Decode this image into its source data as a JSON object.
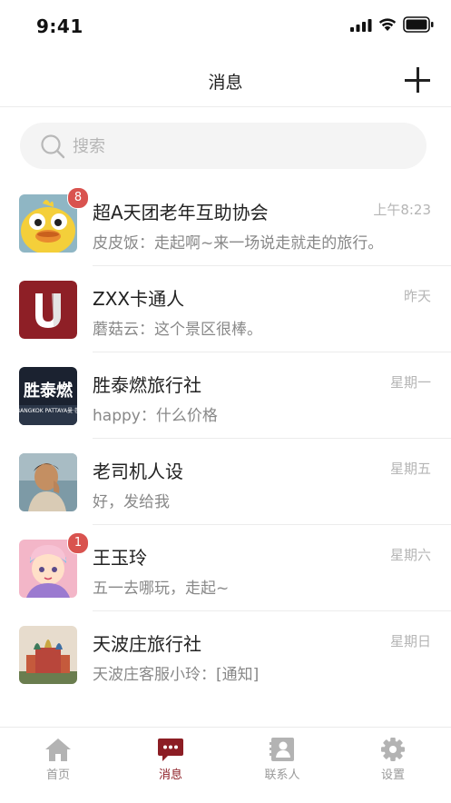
{
  "status_bar": {
    "time": "9:41"
  },
  "header": {
    "title": "消息"
  },
  "search": {
    "placeholder": "搜索"
  },
  "conversations": [
    {
      "name": "超A天团老年互助协会",
      "preview": "皮皮饭：走起啊~来一场说走就走的旅行。",
      "time": "上午8:23",
      "badge": "8"
    },
    {
      "name": "ZXX卡通人",
      "preview": "蘑菇云：这个景区很棒。",
      "time": "昨天"
    },
    {
      "name": "胜泰燃旅行社",
      "preview": "happy：什么价格",
      "time": "星期一",
      "avatar_text": "胜泰燃",
      "avatar_subtext": "BANGKOK PATTAYA曼·芭"
    },
    {
      "name": "老司机人设",
      "preview": "好，发给我",
      "time": "星期五"
    },
    {
      "name": "王玉玲",
      "preview": "五一去哪玩，走起~",
      "time": "星期六",
      "badge": "1"
    },
    {
      "name": "天波庄旅行社",
      "preview": "天波庄客服小玲：[通知]",
      "time": "星期日"
    }
  ],
  "tabs": [
    {
      "label": "首页",
      "icon": "home-icon"
    },
    {
      "label": "消息",
      "icon": "chat-icon",
      "active": true
    },
    {
      "label": "联系人",
      "icon": "contacts-icon"
    },
    {
      "label": "设置",
      "icon": "gear-icon"
    }
  ],
  "colors": {
    "accent": "#8c1d24",
    "badge": "#d9534f",
    "muted": "#b5b5b5"
  }
}
